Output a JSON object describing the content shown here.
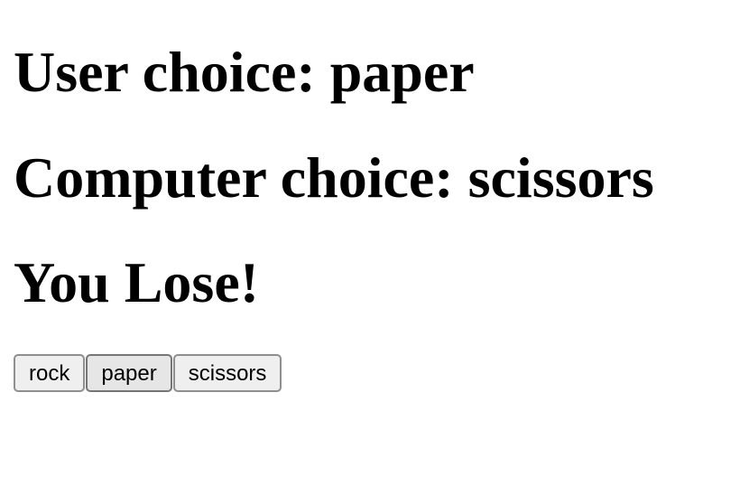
{
  "game": {
    "user_choice_text": "User choice: paper",
    "computer_choice_text": "Computer choice: scissors",
    "result_text": "You Lose!"
  },
  "buttons": [
    {
      "label": "rock"
    },
    {
      "label": "paper"
    },
    {
      "label": "scissors"
    }
  ],
  "colors": {
    "text": "#000000",
    "background": "#ffffff",
    "button_bg": "#efefef",
    "button_border": "#8f8f8f"
  }
}
